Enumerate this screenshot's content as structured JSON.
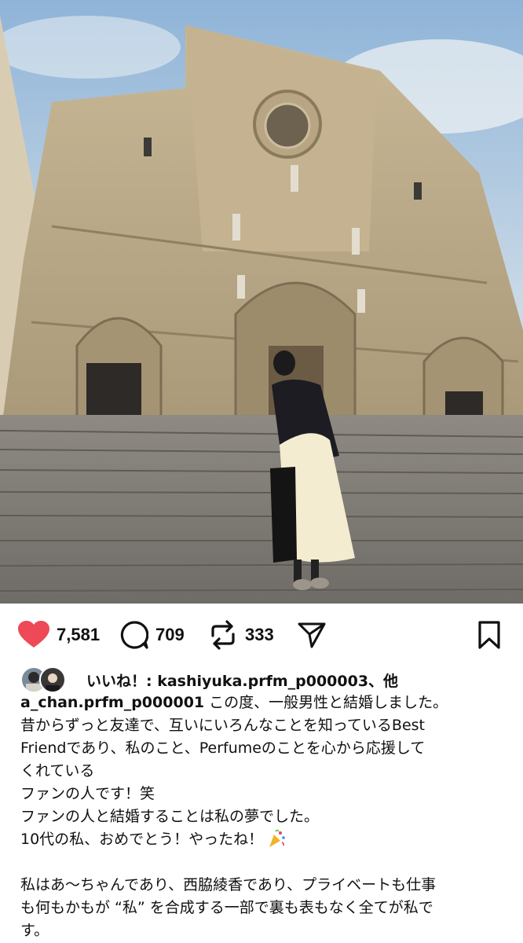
{
  "photo": {
    "subject": "photo-cathedral"
  },
  "actions": {
    "like_count": "7,581",
    "comment_count": "709",
    "repost_count": "333",
    "like_color": "#ed4956",
    "icons": [
      "heart-icon",
      "comment-icon",
      "repost-icon",
      "share-icon",
      "bookmark-icon"
    ]
  },
  "likes": {
    "text": "いいね！: kashiyuka.prfm_p000003、他"
  },
  "caption": {
    "username": "a_chan.prfm_p000001",
    "line1_rest": " この度、一般男性と結婚しました。",
    "line2": "昔からずっと友達で、互いにいろんなことを知っているBest",
    "line3": "Friendであり、私のこと、Perfumeのことを心から応援して",
    "line4": "くれている",
    "line5": "ファンの人です！笑",
    "line6": "ファンの人と結婚することは私の夢でした。",
    "line7": "10代の私、おめでとう！やったね！",
    "line9": "私はあ～ちゃんであり、西脇綾香であり、プライベートも仕事",
    "line10": "も何もかもが “私” を合成する一部で裏も表もなく全てが私で",
    "line11": "す。"
  }
}
